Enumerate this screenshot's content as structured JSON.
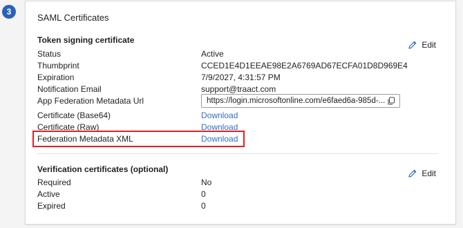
{
  "step": {
    "number": "3"
  },
  "card": {
    "title": "SAML Certificates",
    "token_section": {
      "title": "Token signing certificate",
      "edit_label": "Edit",
      "rows": [
        {
          "label": "Status",
          "value": "Active"
        },
        {
          "label": "Thumbprint",
          "value": "CCED1E4D1EEAE98E2A6769AD67ECFA01D8D969E4"
        },
        {
          "label": "Expiration",
          "value": "7/9/2027, 4:31:57 PM"
        },
        {
          "label": "Notification Email",
          "value": "support@traact.com"
        },
        {
          "label": "App Federation Metadata Url",
          "value": "https://login.microsoftonline.com/e6faed6a-985d-..."
        },
        {
          "label": "Certificate (Base64)",
          "value": "Download"
        },
        {
          "label": "Certificate (Raw)",
          "value": "Download"
        },
        {
          "label": "Federation Metadata XML",
          "value": "Download"
        }
      ]
    },
    "verification_section": {
      "title": "Verification certificates (optional)",
      "edit_label": "Edit",
      "rows": [
        {
          "label": "Required",
          "value": "No"
        },
        {
          "label": "Active",
          "value": "0"
        },
        {
          "label": "Expired",
          "value": "0"
        }
      ]
    }
  },
  "colors": {
    "link": "#2f6fc9",
    "highlight": "#e01f26",
    "badge": "#2b61b8"
  },
  "icons": {
    "edit": "pencil-icon",
    "copy": "copy-icon"
  }
}
